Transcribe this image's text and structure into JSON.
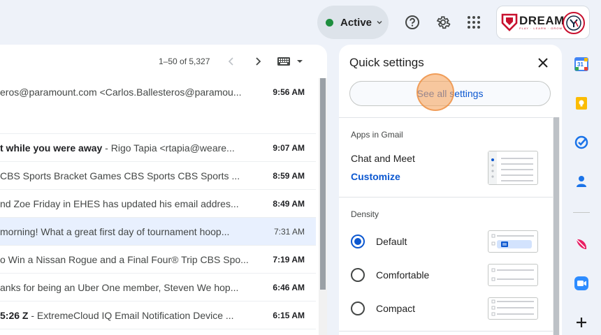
{
  "header": {
    "status_label": "Active",
    "status_color": "#1e8e3e",
    "account_logo_text": "DREAM",
    "account_logo_subtext": "PLAY · LEARN · GROW"
  },
  "mail": {
    "pager": {
      "range_label": "1–50 of 5,327"
    },
    "rows": [
      {
        "sender": "",
        "subject": "",
        "snippet": "eros@paramount.com <Carlos.Ballesteros@paramou...",
        "time": "9:56 AM",
        "state": "unread"
      },
      {
        "sender": "",
        "subject": "t while you were away",
        "snippet": " - Rigo Tapia <rtapia@weare...",
        "time": "9:07 AM",
        "state": "unread"
      },
      {
        "sender": "",
        "subject": "",
        "snippet": "CBS Sports Bracket Games CBS Sports CBS Sports ...",
        "time": "8:59 AM",
        "state": "unread"
      },
      {
        "sender": "",
        "subject": "",
        "snippet": "nd Zoe Friday in EHES has updated his email addres...",
        "time": "8:49 AM",
        "state": "unread"
      },
      {
        "sender": "",
        "subject": "",
        "snippet": " morning! What a great first day of tournament hoop...",
        "time": "7:31 AM",
        "state": "read-selected"
      },
      {
        "sender": "",
        "subject": "",
        "snippet": "o Win a Nissan Rogue and a Final Four® Trip CBS Spo...",
        "time": "7:19 AM",
        "state": "unread"
      },
      {
        "sender": "",
        "subject": "",
        "snippet": "anks for being an Uber One member, Steven We hop...",
        "time": "6:46 AM",
        "state": "unread"
      },
      {
        "sender": "",
        "subject": "5:26 Z",
        "snippet": " - ExtremeCloud IQ Email Notification Device ...",
        "time": "6:15 AM",
        "state": "unread"
      }
    ]
  },
  "quick_settings": {
    "title": "Quick settings",
    "see_all_label": "See all settings",
    "apps_section_label": "Apps in Gmail",
    "chat_meet_label": "Chat and Meet",
    "customize_label": "Customize",
    "density_section_label": "Density",
    "density_options": [
      {
        "label": "Default",
        "checked": true
      },
      {
        "label": "Comfortable",
        "checked": false
      },
      {
        "label": "Compact",
        "checked": false
      }
    ]
  },
  "side_apps": {
    "calendar_day": "31"
  },
  "colors": {
    "accent_blue": "#0b57d0",
    "background": "#eef2f9",
    "click_indicator": "#f7a55f"
  }
}
